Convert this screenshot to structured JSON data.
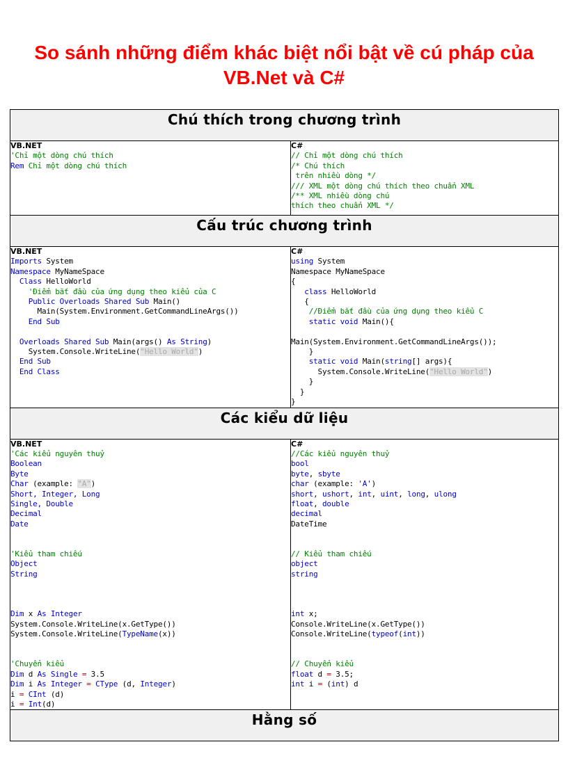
{
  "document": {
    "title": "So sánh những điểm khác biệt nổi bật về cú pháp của VB.Net và C#"
  },
  "labels": {
    "vb": "VB.NET",
    "cs": "C#"
  },
  "sections": [
    {
      "id": "comments",
      "heading": "Chú thích trong chương trình",
      "vb_code_lines": [
        {
          "text": "'Chỉ một dòng chú thích",
          "cls": "cmt"
        },
        {
          "text": "Rem",
          "cls": "kw",
          "rest": " Chỉ một dòng chú thích"
        }
      ],
      "vb_code": "'Chỉ một dòng chú thích\nRem Chỉ một dòng chú thích",
      "cs_code": "// Chỉ một dòng chú thích\n/* Chú thích\n trên nhiều dòng */\n/// XML một dòng chú thích theo chuẩn XML\n/** XML nhiều dòng chú\nthích theo chuẩn XML */"
    },
    {
      "id": "structure",
      "heading": "Cấu trúc chương trình",
      "vb_code": "Imports System\nNamespace MyNameSpace\n  Class HelloWorld\n    'Điểm bắt đầu của ứng dụng theo kiểu của C\n    Public Overloads Shared Sub Main()\n      Main(System.Environment.GetCommandLineArgs())\n    End Sub\n\n  Overloads Shared Sub Main(args() As String)\n    System.Console.WriteLine(\"Hello World\")\n  End Sub\n  End Class",
      "cs_code": "using System\nNamespace MyNameSpace\n{\n   class HelloWorld\n   {\n    //Điểm bắt đầu của ứng dụng theo kiểu C\n    static void Main(){\n\nMain(System.Environment.GetCommandLineArgs());\n    }\n    static void Main(string[] args){\n      System.Console.WriteLine(\"Hello World\")\n    }\n  }\n}"
    },
    {
      "id": "datatypes",
      "heading": "Các kiểu dữ liệu",
      "vb_code": "'Các kiểu nguyên thuỷ\nBoolean\nByte\nChar (example: \"A\")\nShort, Integer, Long\nSingle, Double\nDecimal\nDate\n\n\n'Kiểu tham chiếu\nObject\nString\n\n\n\nDim x As Integer\nSystem.Console.WriteLine(x.GetType())\nSystem.Console.WriteLine(TypeName(x))\n\n\n'Chuyển kiểu\nDim d As Single = 3.5\nDim i As Integer = CType (d, Integer)\ni = CInt (d)\ni = Int(d)",
      "cs_code": "//Các kiểu nguyên thuỷ\nbool\nbyte, sbyte\nchar (example: 'A')\nshort, ushort, int, uint, long, ulong\nfloat, double\ndecimal\nDateTime\n\n\n// Kiểu tham chiếu\nobject\nstring\n\n\n\nint x;\nConsole.WriteLine(x.GetType())\nConsole.WriteLine(typeof(int))\n\n\n// Chuyển kiểu\nfloat d = 3.5;\nint i = (int) d"
    },
    {
      "id": "constants",
      "heading": "Hằng số"
    }
  ],
  "colors": {
    "title": "#FF0000",
    "keyword": "#0000CD",
    "comment": "#008000",
    "string_fg": "#A9A9A9",
    "string_bg": "#E3E3E3",
    "header_bg": "#D4D4D4",
    "border": "#000000"
  }
}
